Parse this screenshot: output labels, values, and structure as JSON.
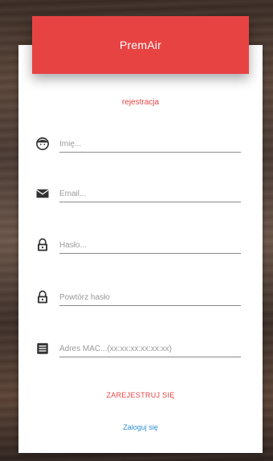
{
  "app": {
    "title": "PremAir"
  },
  "form": {
    "subtitle": "rejestracja",
    "fields": [
      {
        "icon": "face-icon",
        "placeholder": "Imię..."
      },
      {
        "icon": "mail-icon",
        "placeholder": "Email..."
      },
      {
        "icon": "lock-icon",
        "placeholder": "Hasło..."
      },
      {
        "icon": "lock-icon",
        "placeholder": "Powtórz hasło"
      },
      {
        "icon": "list-icon",
        "placeholder": "Adres MAC...(xx:xx:xx:xx:xx:xx)"
      }
    ],
    "register_label": "ZAREJESTRUJ SIĘ",
    "login_label": "Zaloguj się"
  },
  "colors": {
    "accent": "#e84343",
    "link": "#2f8fd3"
  }
}
